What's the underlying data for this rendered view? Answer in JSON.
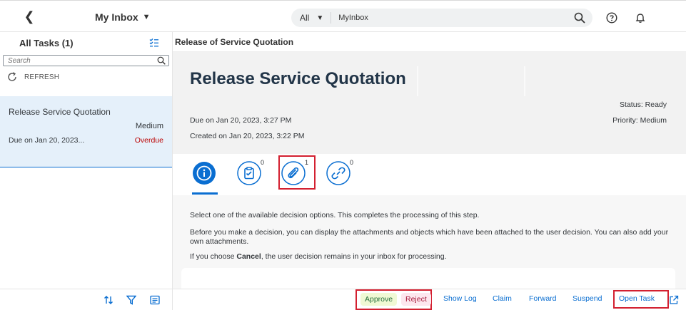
{
  "shell": {
    "app_title": "My Inbox",
    "search_scope": "All",
    "search_value": "MyInbox",
    "icons": [
      "back-icon",
      "chevron-down-icon",
      "search-icon",
      "help-icon",
      "bell-icon"
    ]
  },
  "master": {
    "header": "All Tasks (1)",
    "search_placeholder": "Search",
    "refresh_label": "REFRESH",
    "items": [
      {
        "title": "Release Service Quotation",
        "priority": "Medium",
        "due": "Due on Jan 20, 2023...",
        "status": "Overdue"
      }
    ]
  },
  "detail": {
    "bar_title": "Release of Service Quotation",
    "object_title": "Release Service Quotation",
    "due": "Due on Jan 20, 2023, 3:27 PM",
    "created": "Created on Jan 20, 2023, 3:22 PM",
    "status": "Status: Ready",
    "priority": "Priority: Medium",
    "tabs": [
      {
        "icon": "info-icon",
        "count": ""
      },
      {
        "icon": "notes-icon",
        "count": "0"
      },
      {
        "icon": "attachment-icon",
        "count": "1"
      },
      {
        "icon": "link-icon",
        "count": "0"
      }
    ],
    "info": {
      "p1": "Select one of the available decision options. This completes the processing of this step.",
      "p2": "Before you make a decision, you can display the attachments and objects which have been attached to the user decision. You can also add your own attachments.",
      "p3_pre": "If you choose ",
      "p3_bold": "Cancel",
      "p3_post": ", the user decision remains in your inbox for processing."
    }
  },
  "footer": {
    "approve": "Approve",
    "reject": "Reject",
    "show_log": "Show Log",
    "claim": "Claim",
    "forward": "Forward",
    "suspend": "Suspend",
    "open_task": "Open Task"
  },
  "colors": {
    "accent": "#0a6ed1",
    "overdue": "#bb0000",
    "highlight_box": "#d32030"
  }
}
